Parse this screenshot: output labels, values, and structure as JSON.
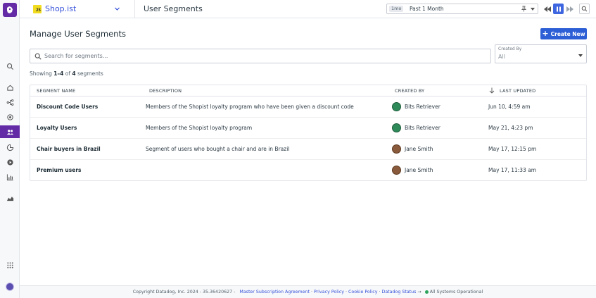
{
  "nav": {
    "logo_icon": "datadog-logo-icon",
    "items": [
      "search-icon",
      "home-icon",
      "nodes-icon",
      "vitals-icon",
      "segments-icon",
      "funnel-icon",
      "play-icon",
      "chart-icon",
      "area-chart-icon"
    ],
    "active_item": "segments-icon",
    "bottom_icons": [
      "apps-grid-icon",
      "user-avatar"
    ],
    "accent_color": "#632ca6"
  },
  "header": {
    "app_badge": "JS",
    "app_name": "Shop.ist",
    "page_title": "User Segments",
    "timepicker": {
      "badge": "1mo",
      "value": "Past 1 Month"
    },
    "pause_color": "#3d66e0"
  },
  "main": {
    "title": "Manage User Segments",
    "create_button": "Create New",
    "search_placeholder": "Search for segments...",
    "created_by": {
      "label": "Created By",
      "value": "All"
    },
    "showing": {
      "prefix": "Showing ",
      "range": "1–4",
      "of": " of ",
      "total": "4",
      "suffix": " segments"
    }
  },
  "table": {
    "headers": {
      "name": "SEGMENT NAME",
      "description": "DESCRIPTION",
      "created_by": "CREATED BY",
      "last_updated": "LAST UPDATED"
    },
    "rows": [
      {
        "name": "Discount Code Users",
        "description": "Members of the Shopist loyalty program who have been given a discount code",
        "creator": "Bits Retriever",
        "avatar": "bits",
        "updated": "Jun 10, 4:59 am"
      },
      {
        "name": "Loyalty Users",
        "description": "Members of the Shopist loyalty program",
        "creator": "Bits Retriever",
        "avatar": "bits",
        "updated": "May 21, 4:23 pm"
      },
      {
        "name": "Chair buyers in Brazil",
        "description": "Segment of users who bought a chair and are in Brazil",
        "creator": "Jane Smith",
        "avatar": "jane",
        "updated": "May 17, 12:15 pm"
      },
      {
        "name": "Premium users",
        "description": "",
        "creator": "Jane Smith",
        "avatar": "jane",
        "updated": "May 17, 11:33 am"
      }
    ]
  },
  "footer": {
    "copyright": "Copyright Datadog, Inc. 2024 - 35.36420627 -",
    "links": [
      "Master Subscription Agreement",
      "Privacy Policy",
      "Cookie Policy",
      "Datadog Status"
    ],
    "arrow": "→",
    "status": "All Systems Operational",
    "status_color": "#2ca35b"
  }
}
